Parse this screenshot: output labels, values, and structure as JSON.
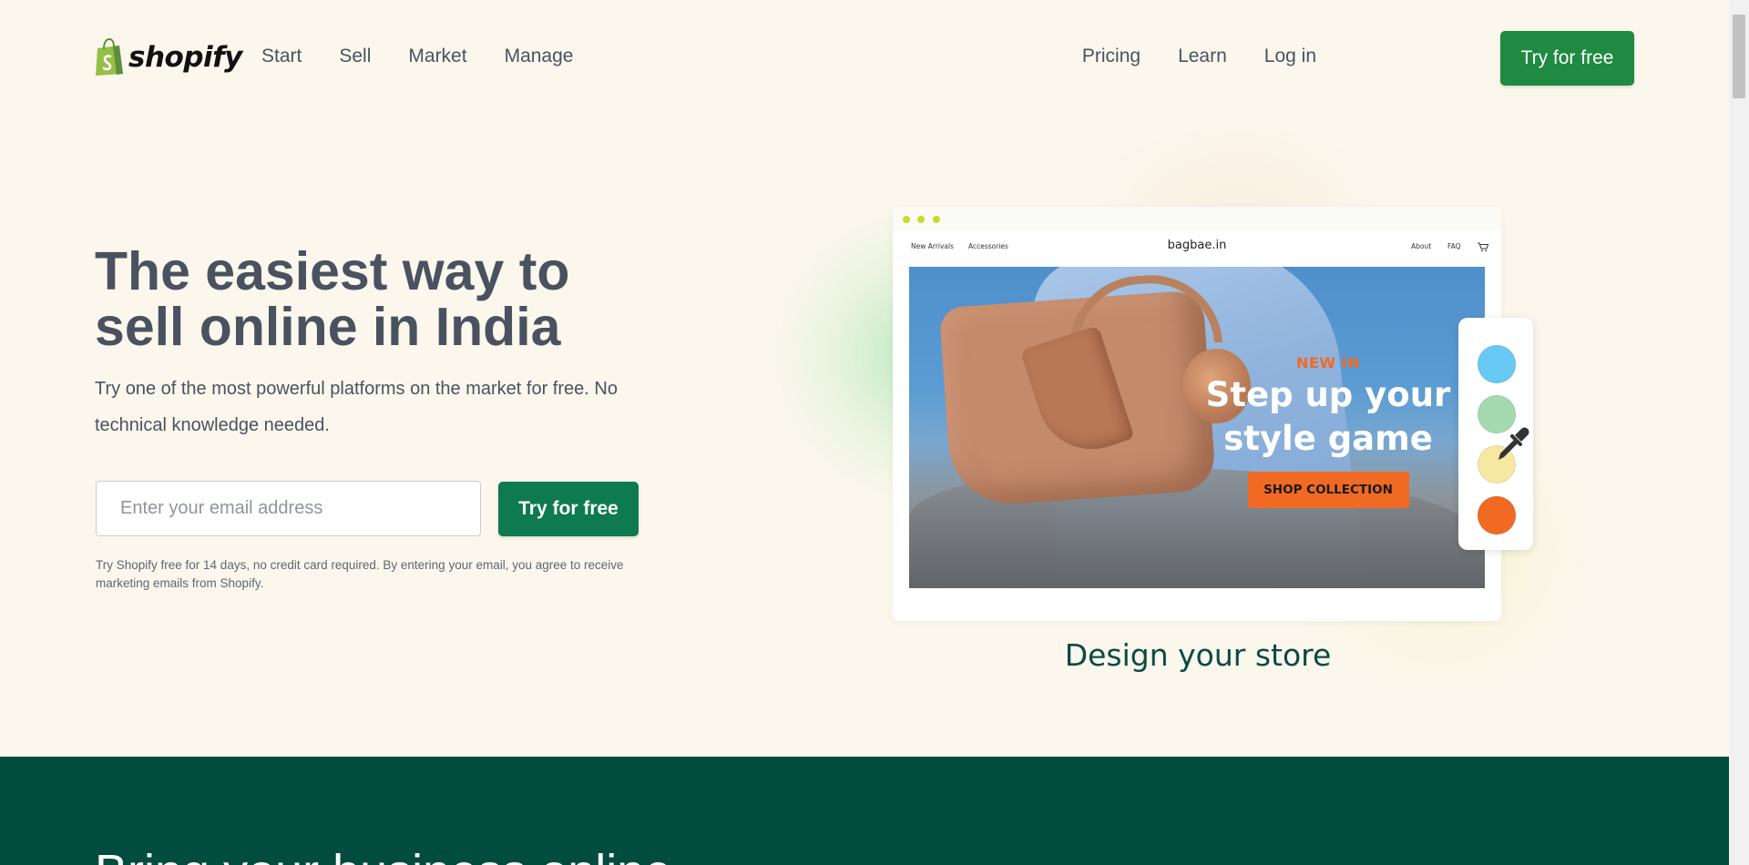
{
  "header": {
    "brand": "shopify",
    "nav_left": [
      "Start",
      "Sell",
      "Market",
      "Manage"
    ],
    "nav_right": [
      "Pricing",
      "Learn",
      "Log in"
    ],
    "cta": "Try for free"
  },
  "hero": {
    "title": "The easiest way to sell online in India",
    "subtitle": "Try one of the most powerful platforms on the market for free. No technical knowledge needed.",
    "email_placeholder": "Enter your email address",
    "cta": "Try for free",
    "disclaimer": "Try Shopify free for 14 days, no credit card required. By entering your email, you agree to receive marketing emails from Shopify."
  },
  "mockup": {
    "nav_left": [
      "New Arrivals",
      "Accessories"
    ],
    "store_name": "bagbae.in",
    "nav_right": [
      "About",
      "FAQ"
    ],
    "cart_icon": "cart-icon",
    "promo_tag": "NEW IN",
    "promo_title": "Step up your style game",
    "promo_button": "SHOP COLLECTION",
    "swatches": [
      "#69c9f5",
      "#a5d9b0",
      "#f6e7a3",
      "#f06a24"
    ],
    "dropper_icon": "eyedropper-icon",
    "caption": "Design your store"
  },
  "band": {
    "heading": "Bring your business online"
  },
  "colors": {
    "background": "#fbf7ed",
    "primary_green": "#1f8a41",
    "hero_button": "#0d7a4f",
    "dark_band": "#004c3f",
    "accent_orange": "#f06a24"
  }
}
